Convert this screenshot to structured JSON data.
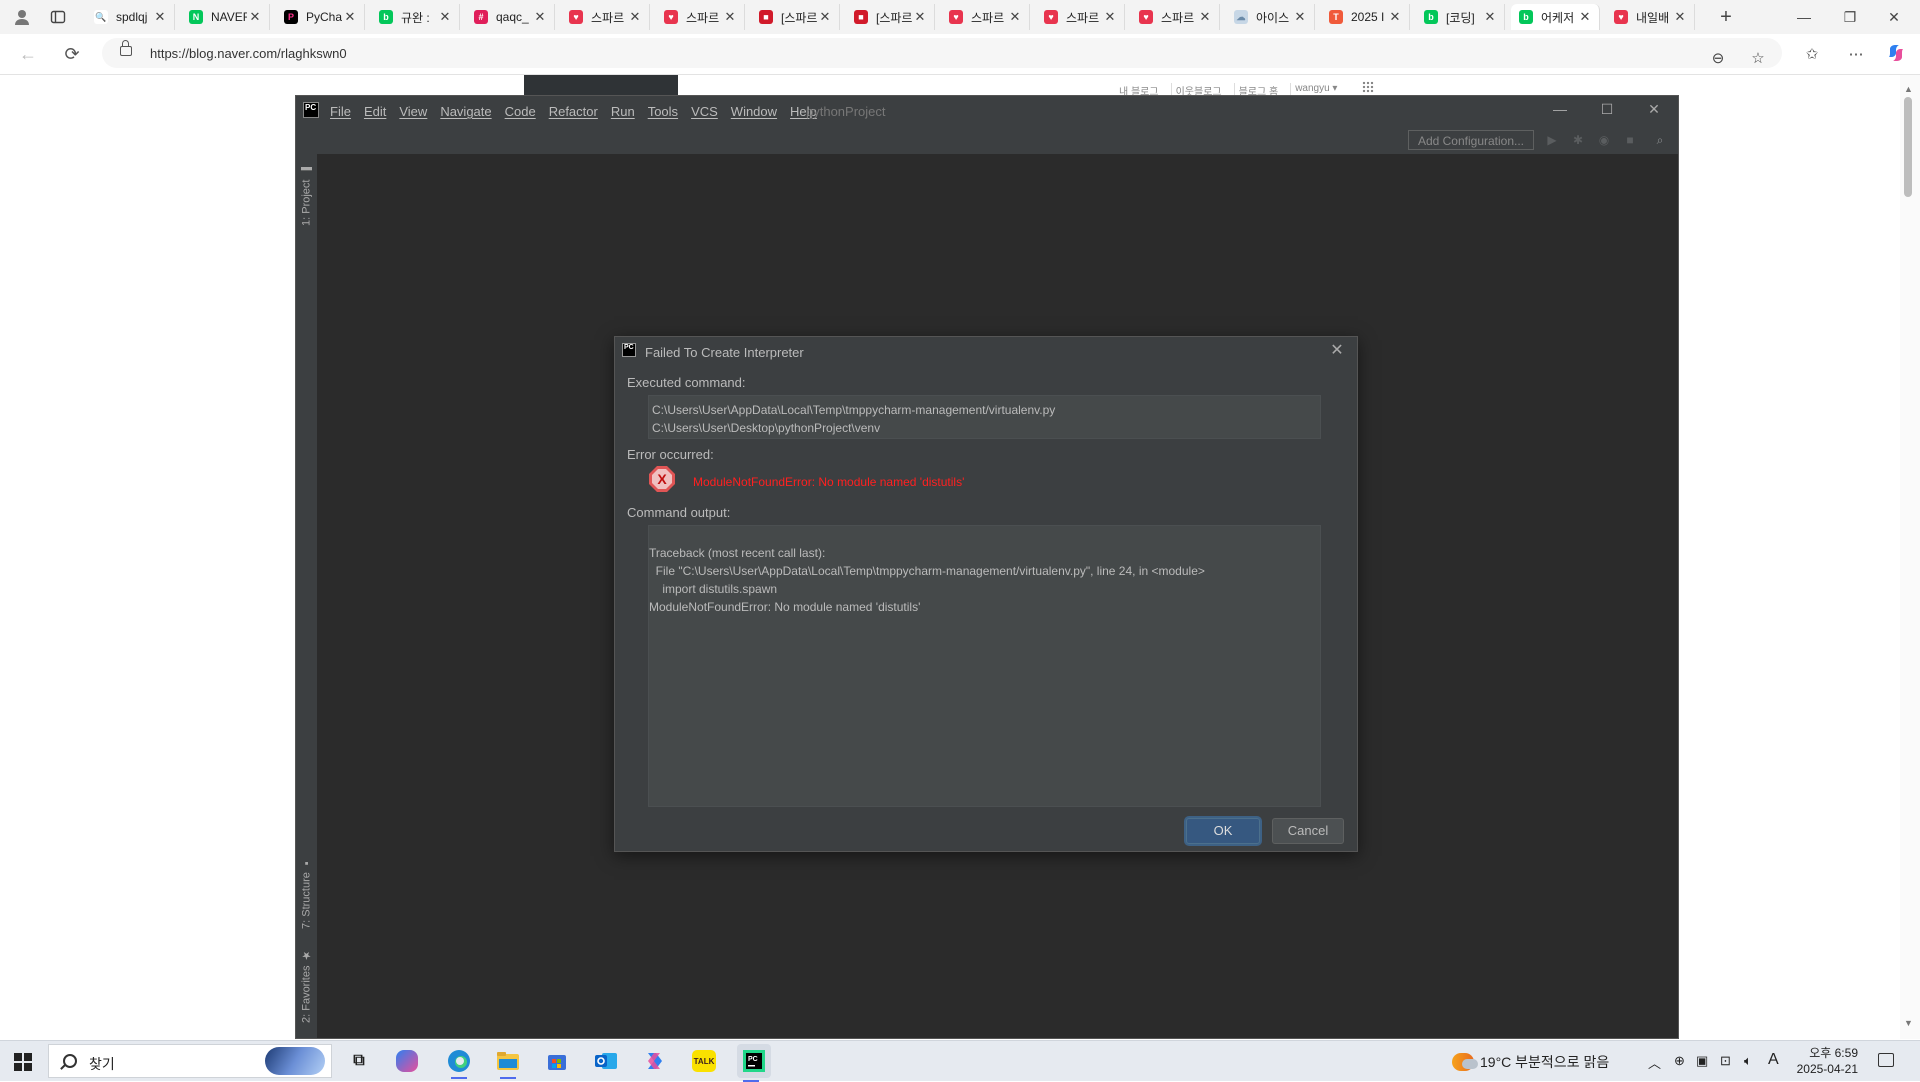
{
  "browser": {
    "tabs": [
      {
        "title": "spdlqj",
        "fav_color": "#ffffff",
        "fav_char": "🔍",
        "fav_text_color": "#333"
      },
      {
        "title": "NAVER",
        "fav_color": "#03c75a",
        "fav_char": "N",
        "fav_text_color": "#ffffff"
      },
      {
        "title": "PyCharm",
        "fav_color": "#000000",
        "fav_char": "P",
        "fav_text_color": "#ff318c"
      },
      {
        "title": "규완 :",
        "fav_color": "#03c75a",
        "fav_char": "b",
        "fav_text_color": "#ffffff"
      },
      {
        "title": "qaqc_",
        "fav_color": "#e01e5a",
        "fav_char": "#",
        "fav_text_color": "#ffffff"
      },
      {
        "title": "스파르",
        "fav_color": "#e8344e",
        "fav_char": "♥",
        "fav_text_color": "#ffffff"
      },
      {
        "title": "스파르",
        "fav_color": "#e8344e",
        "fav_char": "♥",
        "fav_text_color": "#ffffff"
      },
      {
        "title": "[스파르",
        "fav_color": "#d11a2a",
        "fav_char": "■",
        "fav_text_color": "#ffffff"
      },
      {
        "title": "[스파르",
        "fav_color": "#d11a2a",
        "fav_char": "■",
        "fav_text_color": "#ffffff"
      },
      {
        "title": "스파르",
        "fav_color": "#e8344e",
        "fav_char": "♥",
        "fav_text_color": "#ffffff"
      },
      {
        "title": "스파르",
        "fav_color": "#e8344e",
        "fav_char": "♥",
        "fav_text_color": "#ffffff"
      },
      {
        "title": "스파르",
        "fav_color": "#e8344e",
        "fav_char": "♥",
        "fav_text_color": "#ffffff"
      },
      {
        "title": "아이스",
        "fav_color": "#c7d7e6",
        "fav_char": "☁",
        "fav_text_color": "#6a8aa8"
      },
      {
        "title": "2025 I",
        "fav_color": "#f05a3a",
        "fav_char": "T",
        "fav_text_color": "#ffffff"
      },
      {
        "title": "[코딩]",
        "fav_color": "#03c75a",
        "fav_char": "b",
        "fav_text_color": "#ffffff"
      },
      {
        "title": "어케저",
        "fav_color": "#03c75a",
        "fav_char": "b",
        "fav_text_color": "#ffffff",
        "active": true
      },
      {
        "title": "내일배",
        "fav_color": "#e8344e",
        "fav_char": "♥",
        "fav_text_color": "#ffffff"
      }
    ],
    "url": "https://blog.naver.com/rlaghkswn0"
  },
  "blog": {
    "links": [
      "내 블로그",
      "이웃블로그",
      "블로그 홈",
      "wangyu ▾"
    ]
  },
  "ide": {
    "menu": [
      "File",
      "Edit",
      "View",
      "Navigate",
      "Code",
      "Refactor",
      "Run",
      "Tools",
      "VCS",
      "Window",
      "Help"
    ],
    "project_name": "pythonProject",
    "add_config_label": "Add Configuration...",
    "side_tabs": {
      "project": "1: Project",
      "structure": "7: Structure",
      "favorites": "2: Favorites"
    },
    "logo_text": "PC"
  },
  "dialog": {
    "title": "Failed To Create Interpreter",
    "executed_label": "Executed command:",
    "command_lines": [
      "C:\\Users\\User\\AppData\\Local\\Temp\\tmppycharm-management/virtualenv.py",
      "C:\\Users\\User\\Desktop\\pythonProject\\venv"
    ],
    "error_label": "Error occurred:",
    "error_message": "ModuleNotFoundError: No module named 'distutils'",
    "output_label": "Command output:",
    "output_lines": [
      "Traceback (most recent call last):",
      "  File \"C:\\Users\\User\\AppData\\Local\\Temp\\tmppycharm-management/virtualenv.py\", line 24, in <module>",
      "    import distutils.spawn",
      "ModuleNotFoundError: No module named 'distutils'"
    ],
    "ok_label": "OK",
    "cancel_label": "Cancel"
  },
  "taskbar": {
    "search_placeholder": "찾기",
    "weather": "19°C  부분적으로 맑음",
    "clock_time": "오후 6:59",
    "clock_date": "2025-04-21",
    "ime_indicator": "A"
  },
  "colors": {
    "ide_background": "#2b2b2b",
    "ide_panel": "#3c3f41",
    "error_red": "#ff2020",
    "ok_button": "#365880"
  }
}
